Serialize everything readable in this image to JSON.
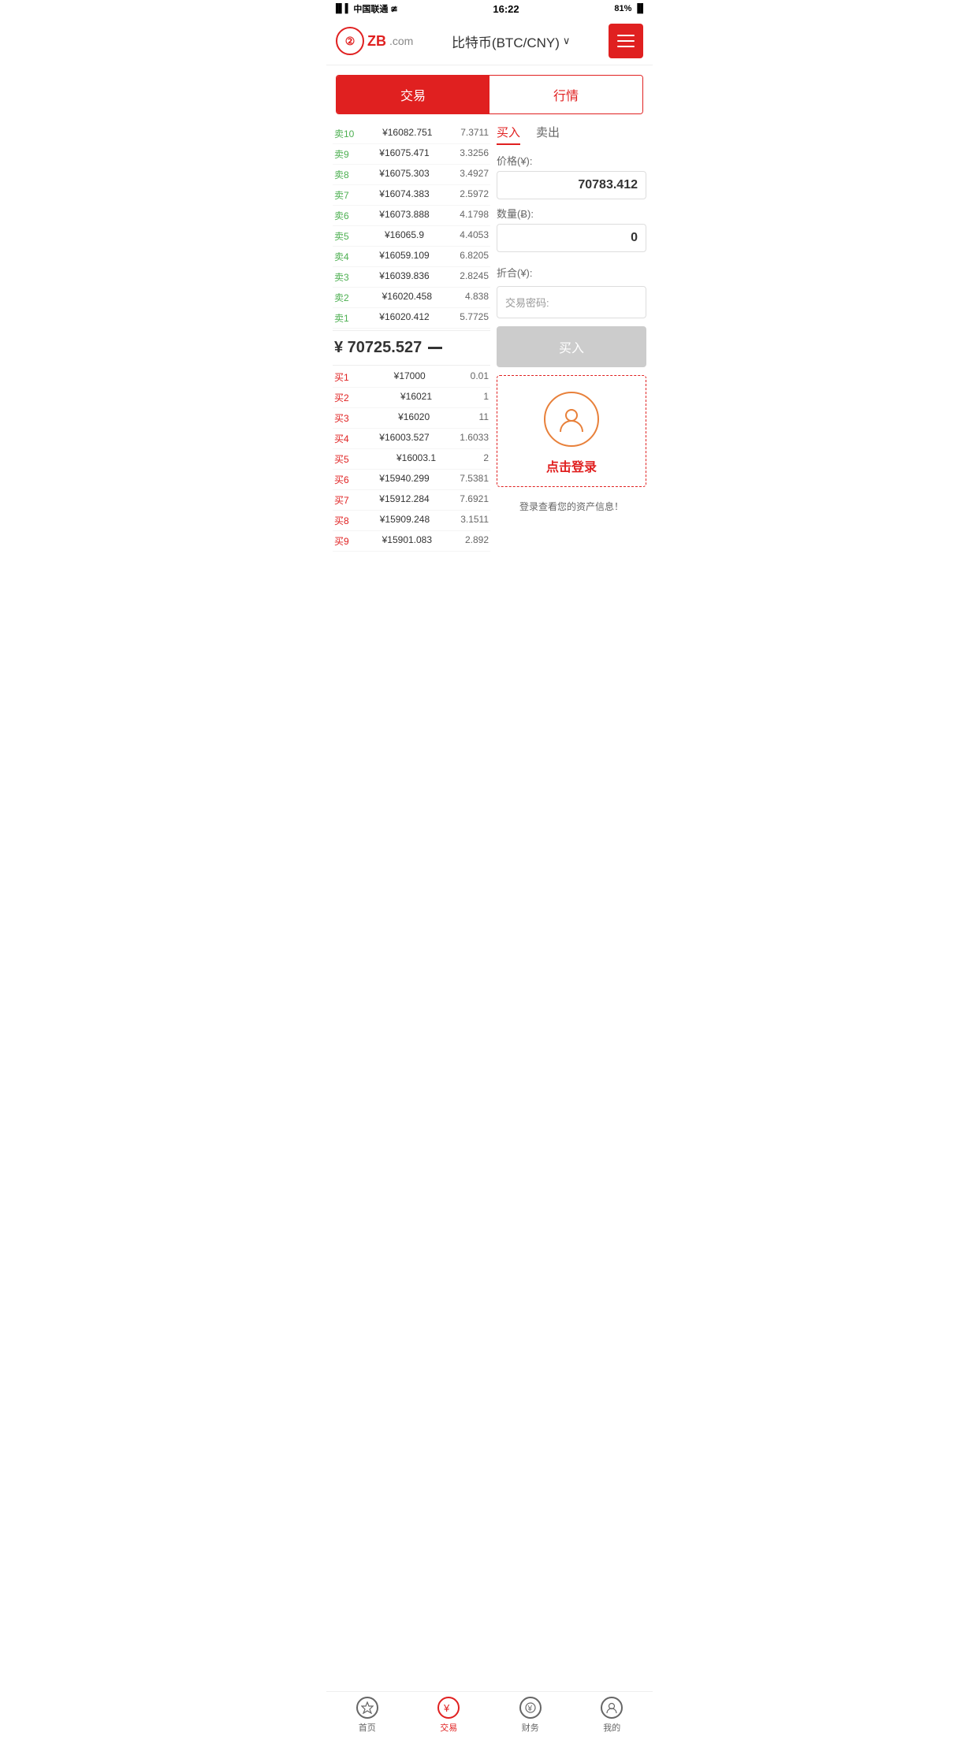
{
  "statusBar": {
    "carrier": "中国联通",
    "time": "16:22",
    "battery": "81%"
  },
  "header": {
    "logoText": "ZB",
    "logoDomain": ".com",
    "title": "比特币(BTC/CNY)",
    "dropdownArrow": "∨"
  },
  "tabs": {
    "trade": "交易",
    "market": "行情"
  },
  "tradeTabs": {
    "buy": "买入",
    "sell": "卖出"
  },
  "tradeForm": {
    "priceLabel": "价格(¥):",
    "priceValue": "70783.412",
    "amountLabel": "数量(Ƀ):",
    "amountValue": "0",
    "totalLabel": "折合(¥):",
    "totalValue": "",
    "passwordLabel": "交易密码:",
    "buyButtonLabel": "买入"
  },
  "loginPrompt": {
    "loginText": "点击登录",
    "assetInfo": "登录查看您的资产信息！"
  },
  "sellOrders": [
    {
      "label": "卖10",
      "price": "¥16082.751",
      "amount": "7.3711"
    },
    {
      "label": "卖9",
      "price": "¥16075.471",
      "amount": "3.3256"
    },
    {
      "label": "卖8",
      "price": "¥16075.303",
      "amount": "3.4927"
    },
    {
      "label": "卖7",
      "price": "¥16074.383",
      "amount": "2.5972"
    },
    {
      "label": "卖6",
      "price": "¥16073.888",
      "amount": "4.1798"
    },
    {
      "label": "卖5",
      "price": "¥16065.9",
      "amount": "4.4053"
    },
    {
      "label": "卖4",
      "price": "¥16059.109",
      "amount": "6.8205"
    },
    {
      "label": "卖3",
      "price": "¥16039.836",
      "amount": "2.8245"
    },
    {
      "label": "卖2",
      "price": "¥16020.458",
      "amount": "4.838"
    },
    {
      "label": "卖1",
      "price": "¥16020.412",
      "amount": "5.7725"
    }
  ],
  "midPrice": "¥ 70725.527",
  "buyOrders": [
    {
      "label": "买1",
      "price": "¥17000",
      "amount": "0.01"
    },
    {
      "label": "买2",
      "price": "¥16021",
      "amount": "1"
    },
    {
      "label": "买3",
      "price": "¥16020",
      "amount": "11"
    },
    {
      "label": "买4",
      "price": "¥16003.527",
      "amount": "1.6033"
    },
    {
      "label": "买5",
      "price": "¥16003.1",
      "amount": "2"
    },
    {
      "label": "买6",
      "price": "¥15940.299",
      "amount": "7.5381"
    },
    {
      "label": "买7",
      "price": "¥15912.284",
      "amount": "7.6921"
    },
    {
      "label": "买8",
      "price": "¥15909.248",
      "amount": "3.1511"
    },
    {
      "label": "买9",
      "price": "¥15901.083",
      "amount": "2.892"
    }
  ],
  "bottomNav": [
    {
      "label": "首页",
      "icon": "star",
      "active": false
    },
    {
      "label": "交易",
      "icon": "yen",
      "active": true
    },
    {
      "label": "财务",
      "icon": "money",
      "active": false
    },
    {
      "label": "我的",
      "icon": "user",
      "active": false
    }
  ]
}
